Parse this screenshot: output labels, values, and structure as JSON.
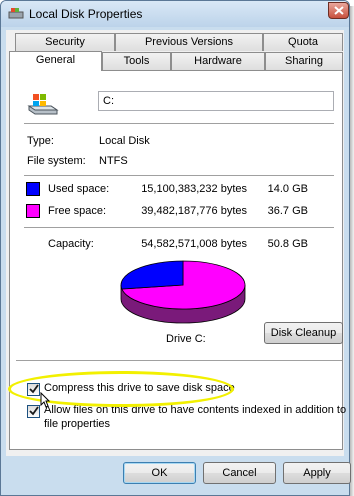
{
  "window": {
    "title": "Local Disk Properties"
  },
  "tabs_row1": [
    {
      "label": "Security"
    },
    {
      "label": "Previous Versions"
    },
    {
      "label": "Quota"
    }
  ],
  "tabs_row2": [
    {
      "label": "General",
      "active": true
    },
    {
      "label": "Tools"
    },
    {
      "label": "Hardware"
    },
    {
      "label": "Sharing"
    }
  ],
  "general": {
    "name_value": "C:",
    "type_label": "Type:",
    "type_value": "Local Disk",
    "fs_label": "File system:",
    "fs_value": "NTFS",
    "used": {
      "label": "Used space:",
      "bytes": "15,100,383,232 bytes",
      "gb": "14.0 GB",
      "color": "#0000ff"
    },
    "free": {
      "label": "Free space:",
      "bytes": "39,482,187,776 bytes",
      "gb": "36.7 GB",
      "color": "#ff00ff"
    },
    "capacity": {
      "label": "Capacity:",
      "bytes": "54,582,571,008 bytes",
      "gb": "50.8 GB"
    },
    "drive_label": "Drive C:",
    "used_fraction": 0.2767,
    "disk_cleanup_label": "Disk Cleanup",
    "compress": {
      "label": "Compress this drive to save disk space",
      "checked": true
    },
    "index": {
      "label_line1": "Allow files on this drive to have contents indexed in addition to",
      "label_line2": "file properties",
      "checked": true
    }
  },
  "buttons": {
    "ok": "OK",
    "cancel": "Cancel",
    "apply": "Apply"
  },
  "colors": {
    "highlight": "#f2f000",
    "titlebar": "#bcd3ea"
  }
}
